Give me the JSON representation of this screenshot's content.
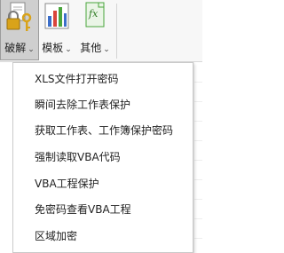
{
  "ribbon": {
    "buttons": [
      {
        "label": "破解",
        "icon": "lock-key-icon",
        "chevron": "⌄"
      },
      {
        "label": "模板",
        "icon": "spreadsheet-template-icon",
        "chevron": "⌄"
      },
      {
        "label": "其他",
        "icon": "fx-function-icon",
        "chevron": "⌄"
      }
    ]
  },
  "menu": {
    "items": [
      "XLS文件打开密码",
      "瞬间去除工作表保护",
      "获取工作表、工作簿保护密码",
      "强制读取VBA代码",
      "VBA工程保护",
      "免密码查看VBA工程",
      "区域加密"
    ]
  },
  "colors": {
    "selected_button_bg": "#cfcfcf",
    "menu_border": "#cacaca",
    "icon_blue": "#3b6ec9",
    "icon_green": "#4aa53c",
    "icon_red": "#d9453b",
    "icon_gold": "#d9a31a"
  }
}
